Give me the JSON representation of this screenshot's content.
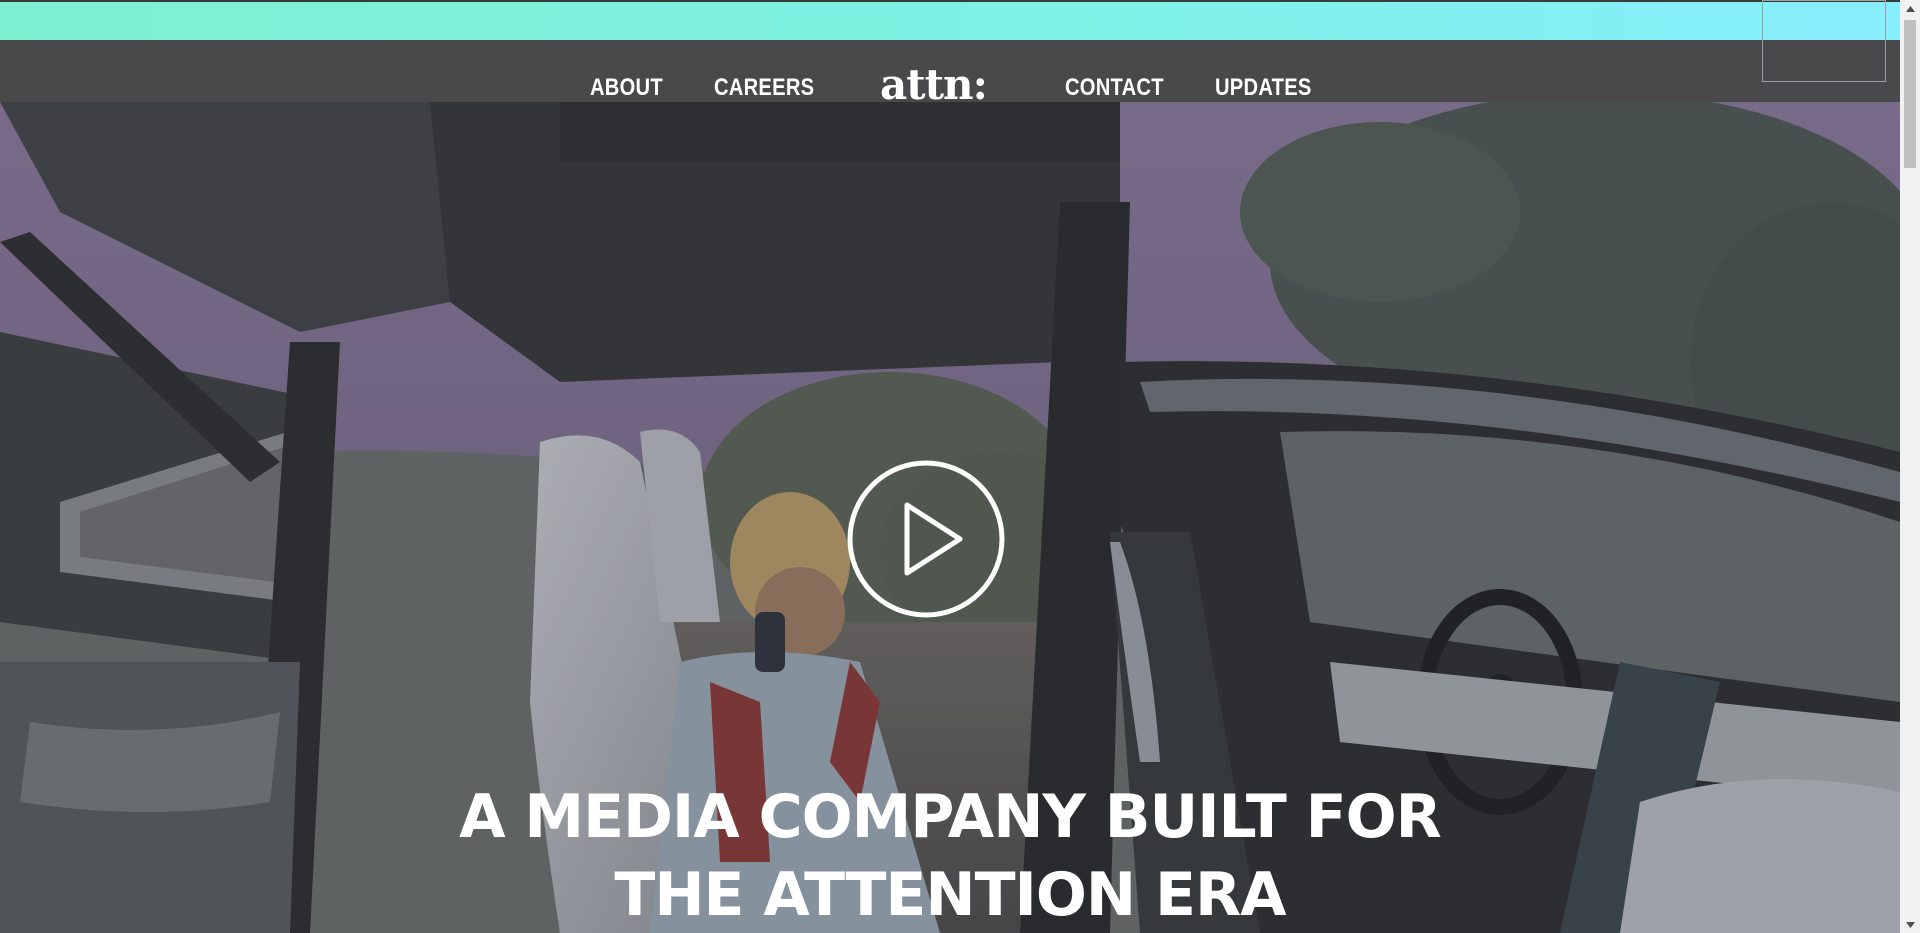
{
  "nav": {
    "about": "ABOUT",
    "careers": "CAREERS",
    "logo": "attn:",
    "contact": "CONTACT",
    "updates": "UPDATES"
  },
  "hero": {
    "headline_line1": "A MEDIA COMPANY BUILT FOR",
    "headline_line2": "THE ATTENTION ERA",
    "play_icon": "play-icon"
  },
  "colors": {
    "top_bar_start": "#7df0d2",
    "top_bar_end": "#86eefc",
    "header_bg": "#49494b",
    "text": "#ffffff"
  }
}
